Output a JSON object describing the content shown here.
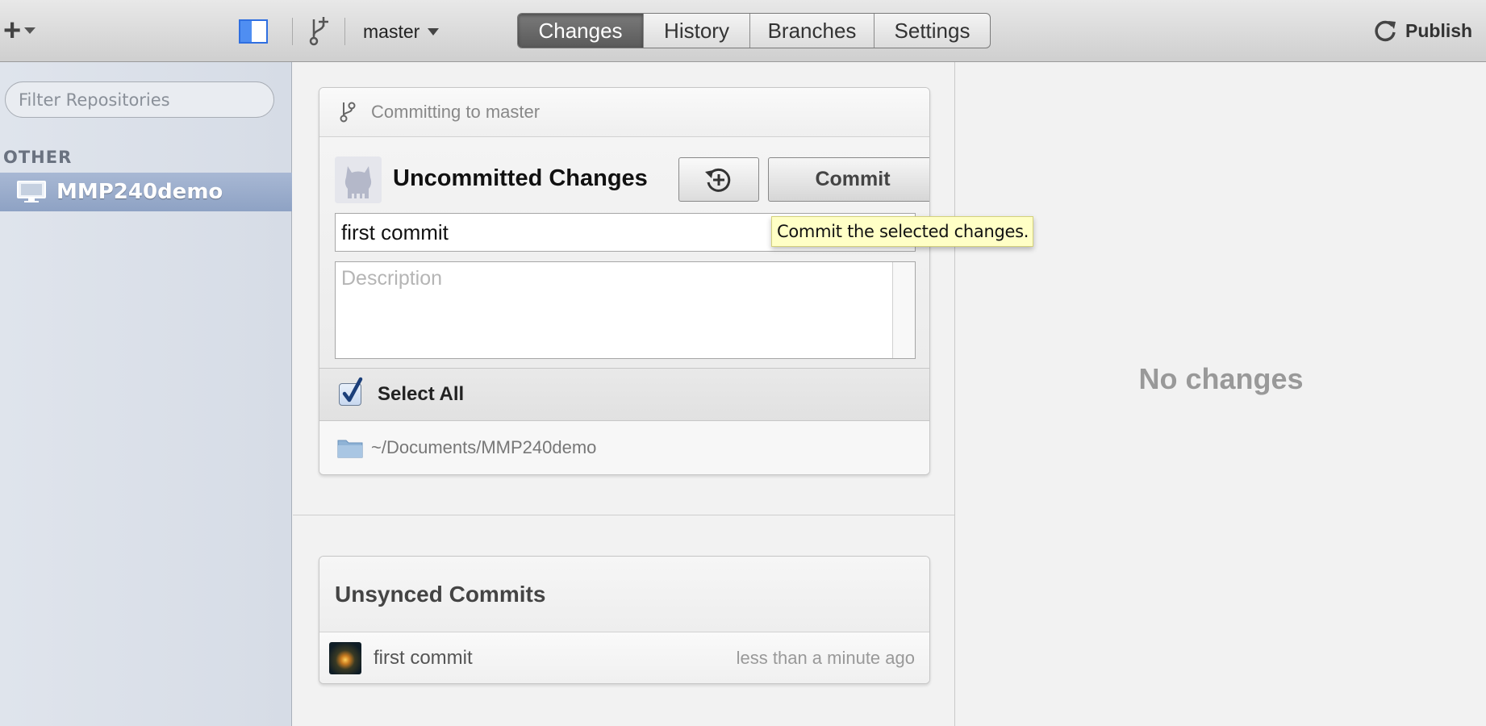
{
  "toolbar": {
    "branch_name": "master",
    "tabs": [
      {
        "label": "Changes",
        "active": true
      },
      {
        "label": "History",
        "active": false
      },
      {
        "label": "Branches",
        "active": false
      },
      {
        "label": "Settings",
        "active": false
      }
    ],
    "publish_label": "Publish",
    "icons": {
      "add": "plus-icon",
      "sidebar_toggle": "sidebar-toggle-icon",
      "branch": "branch-add-icon",
      "publish": "sync-icon"
    }
  },
  "sidebar": {
    "filter_placeholder": "Filter Repositories",
    "section_title": "OTHER",
    "repos": [
      {
        "name": "MMP240demo",
        "selected": true,
        "icon": "monitor-icon"
      }
    ]
  },
  "commit_panel": {
    "header": "Committing to master",
    "title": "Uncommitted Changes",
    "commit_button": "Commit",
    "summary_value": "first commit",
    "description_placeholder": "Description",
    "select_all_label": "Select All",
    "select_all_checked": true,
    "repo_path": "~/Documents/MMP240demo"
  },
  "tooltip": {
    "text": "Commit the selected changes."
  },
  "unsynced": {
    "title": "Unsynced Commits",
    "commits": [
      {
        "message": "first commit",
        "time": "less than a minute ago"
      }
    ]
  },
  "diff_pane": {
    "empty_message": "No changes"
  },
  "colors": {
    "accent_blue": "#2f6fe0",
    "sidebar_selection": "#8ea2c4",
    "tooltip_bg": "#ffffc6",
    "active_tab": "#5a5a5a"
  }
}
